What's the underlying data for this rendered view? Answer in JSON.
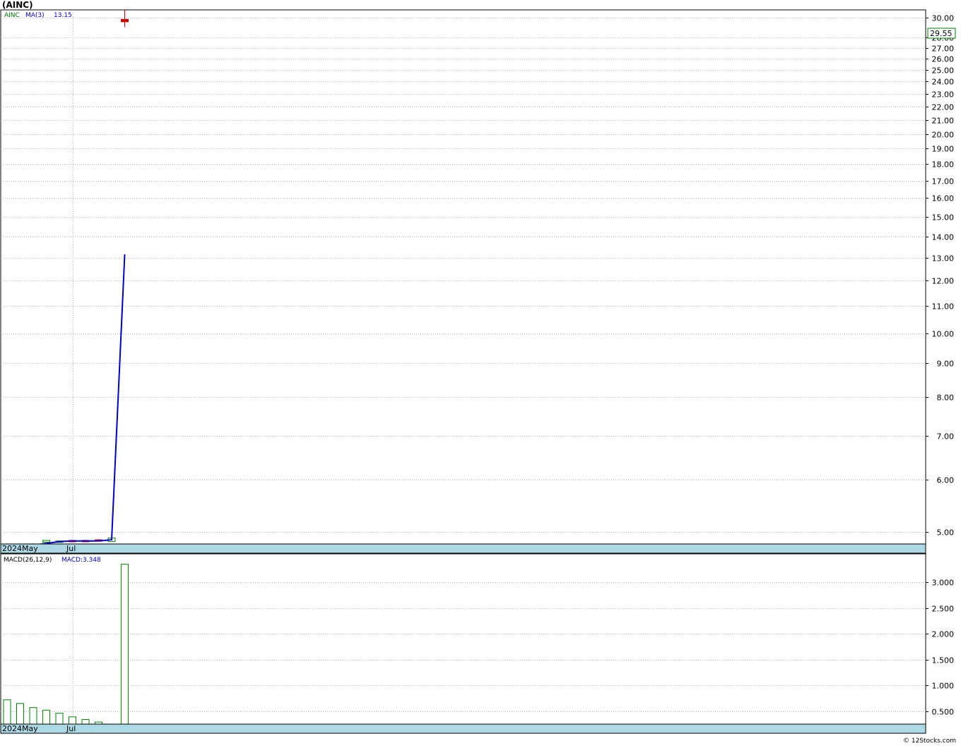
{
  "title": "(AINC)",
  "watermark": "© 12Stocks.com",
  "colors": {
    "up": "#008000",
    "down": "#cc0000",
    "ma": "#0000cc",
    "price_box": "#008000",
    "date_strip": "#add8e6",
    "legend_green": "#007700",
    "legend_blue": "#0000cc"
  },
  "chart_data": [
    {
      "type": "candlestick",
      "symbol": "AINC",
      "legend": {
        "symbol": "AINC",
        "ma_label": "MA(3)",
        "ma_value": "13.15"
      },
      "current_price": "29.55",
      "scale": "log",
      "ylim": [
        4.8,
        30.8
      ],
      "x_labels": [
        "2024May",
        "Jul"
      ],
      "y_ticks": [
        {
          "value": 30,
          "label": "30.00"
        },
        {
          "value": 28,
          "label": "28.00"
        },
        {
          "value": 27,
          "label": "27.00"
        },
        {
          "value": 26,
          "label": "26.00"
        },
        {
          "value": 25,
          "label": "25.00"
        },
        {
          "value": 24,
          "label": "24.00"
        },
        {
          "value": 23,
          "label": "23.00"
        },
        {
          "value": 22,
          "label": "22.00"
        },
        {
          "value": 21,
          "label": "21.00"
        },
        {
          "value": 20,
          "label": "20.00"
        },
        {
          "value": 19,
          "label": "19.00"
        },
        {
          "value": 18,
          "label": "18.00"
        },
        {
          "value": 17,
          "label": "17.00"
        },
        {
          "value": 16,
          "label": "16.00"
        },
        {
          "value": 15,
          "label": "15.00"
        },
        {
          "value": 14,
          "label": "14.00"
        },
        {
          "value": 13,
          "label": "13.00"
        },
        {
          "value": 12,
          "label": "12.00"
        },
        {
          "value": 11,
          "label": "11.00"
        },
        {
          "value": 10,
          "label": "10.00"
        },
        {
          "value": 9,
          "label": "9.00"
        },
        {
          "value": 8,
          "label": "8.00"
        },
        {
          "value": 7,
          "label": "7.00"
        },
        {
          "value": 6,
          "label": "6.00"
        },
        {
          "value": 5,
          "label": "5.00"
        }
      ],
      "candles": [
        {
          "open": 4.79,
          "high": 4.8,
          "low": 4.77,
          "close": 4.77
        },
        {
          "open": 4.77,
          "high": 4.78,
          "low": 4.76,
          "close": 4.77
        },
        {
          "open": 4.79,
          "high": 4.81,
          "low": 4.78,
          "close": 4.8
        },
        {
          "open": 4.83,
          "high": 4.86,
          "low": 4.82,
          "close": 4.86
        },
        {
          "open": 4.85,
          "high": 4.86,
          "low": 4.84,
          "close": 4.85
        },
        {
          "open": 4.86,
          "high": 4.87,
          "low": 4.85,
          "close": 4.85
        },
        {
          "open": 4.86,
          "high": 4.87,
          "low": 4.85,
          "close": 4.85
        },
        {
          "open": 4.87,
          "high": 4.88,
          "low": 4.86,
          "close": 4.86
        },
        {
          "open": 4.84,
          "high": 4.9,
          "low": 4.84,
          "close": 4.9
        },
        {
          "open": 29.8,
          "high": 30.8,
          "low": 29.0,
          "close": 29.55
        }
      ],
      "ma": [
        4.77,
        4.77,
        4.78,
        4.81,
        4.84,
        4.85,
        4.85,
        4.85,
        4.87,
        13.15
      ]
    },
    {
      "type": "bar",
      "legend": {
        "label": "MACD(26,12,9)",
        "value_label": "MACD:3.348"
      },
      "ylim": [
        0.25,
        3.55
      ],
      "x_labels": [
        "2024May",
        "Jul"
      ],
      "y_ticks": [
        {
          "value": 3.0,
          "label": "3.000"
        },
        {
          "value": 2.5,
          "label": "2.500"
        },
        {
          "value": 2.0,
          "label": "2.000"
        },
        {
          "value": 1.5,
          "label": "1.500"
        },
        {
          "value": 1.0,
          "label": "1.000"
        },
        {
          "value": 0.5,
          "label": "0.500"
        }
      ],
      "values": [
        0.72,
        0.65,
        0.57,
        0.52,
        0.46,
        0.39,
        0.34,
        0.29,
        3.348
      ]
    }
  ]
}
